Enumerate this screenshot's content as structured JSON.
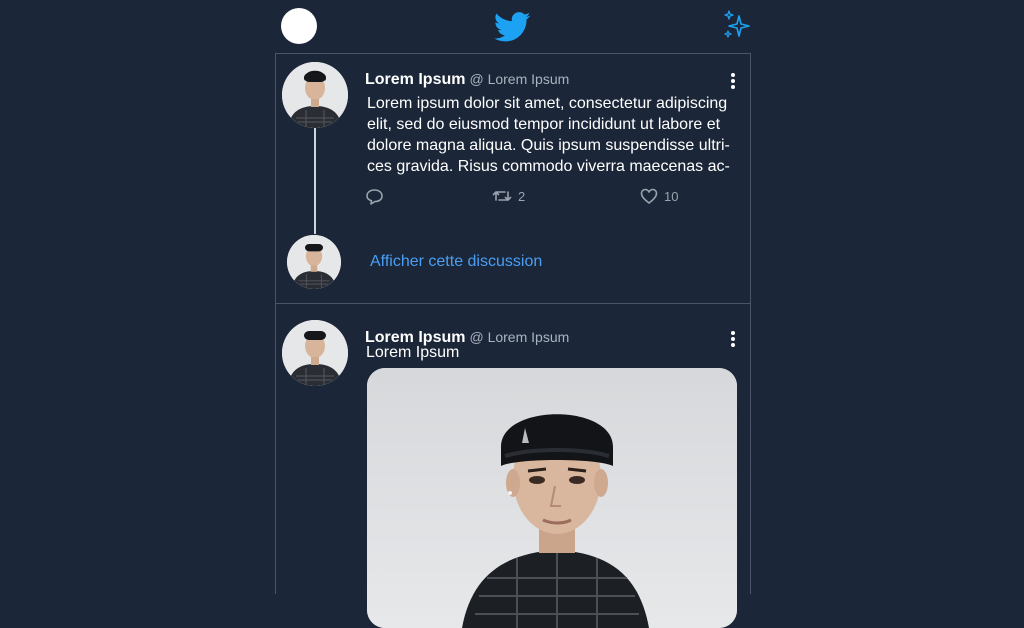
{
  "header": {
    "logo": "twitter-bird-icon",
    "action": "sparkle-icon"
  },
  "tweets": [
    {
      "author": "Lorem Ipsum",
      "handle": "@ Lorem Ipsum",
      "text": "Lorem ipsum dolor sit amet, consectetur adipiscing elit, sed do eiusmod tempor incididunt ut labore et dolore magna aliqua. Quis ipsum suspendisse ultri-ces gravida. Risus commodo viverra maecenas ac-",
      "retweets": "2",
      "likes": "10",
      "show_thread": "Afficher cette discussion"
    },
    {
      "author": "Lorem Ipsum",
      "handle": "@ Lorem Ipsum",
      "text": "Lorem Ipsum"
    }
  ],
  "colors": {
    "background": "#1b2638",
    "link": "#4a9ff5",
    "brand": "#1da1f2"
  }
}
